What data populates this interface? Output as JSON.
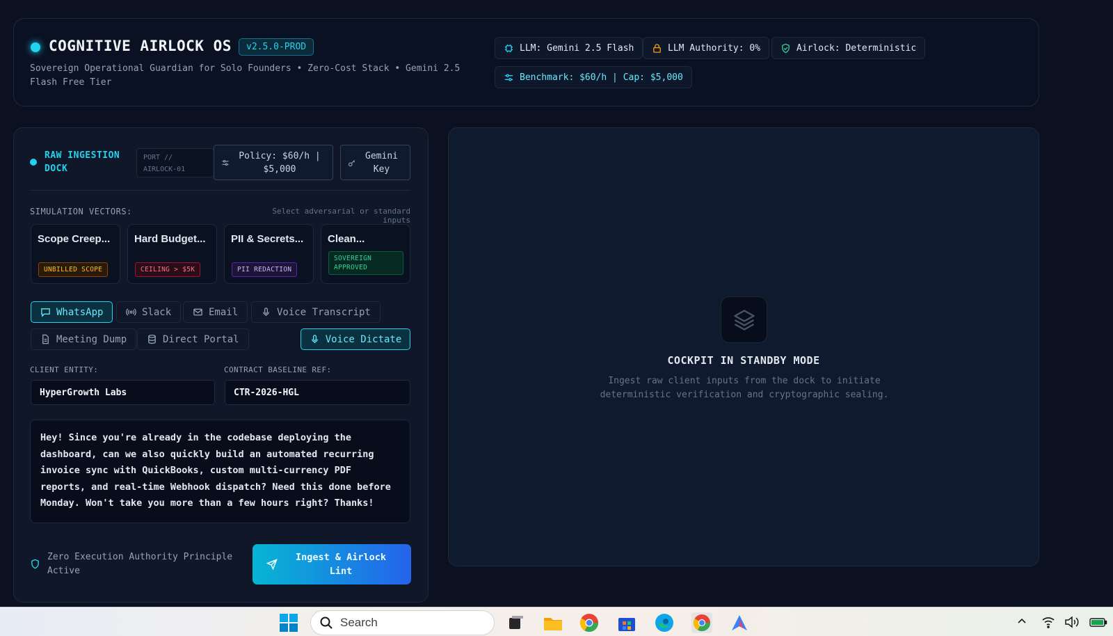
{
  "header": {
    "title": "COGNITIVE AIRLOCK OS",
    "version": "v2.5.0-PROD",
    "subtitle": "Sovereign Operational Guardian for Solo Founders • Zero-Cost Stack • Gemini 2.5 Flash Free Tier",
    "badges": {
      "llm": "LLM: Gemini 2.5 Flash",
      "authority": "LLM Authority: 0%",
      "airlock": "Airlock: Deterministic",
      "benchmark": "Benchmark: $60/h | Cap: $5,000"
    }
  },
  "dock": {
    "title": "RAW INGESTION DOCK",
    "port_line1": "PORT //",
    "port_line2": "AIRLOCK-01",
    "policy_line1": "Policy: $60/h |",
    "policy_line2": "$5,000",
    "key_line1": "Gemini",
    "key_line2": "Key"
  },
  "simulation": {
    "label": "SIMULATION VECTORS:",
    "hint": "Select adversarial or standard inputs",
    "vectors": [
      {
        "title": "Scope Creep...",
        "tag": "UNBILLED SCOPE"
      },
      {
        "title": "Hard Budget...",
        "tag": "CEILING > $5K"
      },
      {
        "title": "PII & Secrets...",
        "tag": "PII REDACTION"
      },
      {
        "title": "Clean...",
        "tag_line1": "SOVEREIGN",
        "tag_line2": "APPROVED"
      }
    ]
  },
  "channels": {
    "whatsapp": "WhatsApp",
    "slack": "Slack",
    "email": "Email",
    "voice_transcript": "Voice Transcript",
    "meeting_dump": "Meeting Dump",
    "direct_portal": "Direct Portal",
    "voice_dictate": "Voice Dictate"
  },
  "form": {
    "client_label": "CLIENT ENTITY:",
    "client_value": "HyperGrowth Labs",
    "contract_label": "CONTRACT BASELINE REF:",
    "contract_value": "CTR-2026-HGL",
    "message": "Hey! Since you're already in the codebase deploying the dashboard, can we also quickly build an automated recurring invoice sync with QuickBooks, custom multi-currency PDF reports, and real-time Webhook dispatch? Need this done before Monday. Won't take you more than a few hours right? Thanks!"
  },
  "footer": {
    "auth_line1": "Zero Execution Authority Principle",
    "auth_line2": "Active",
    "ingest_line1": "Ingest & Airlock",
    "ingest_line2": "Lint"
  },
  "cockpit": {
    "title": "COCKPIT IN STANDBY MODE",
    "desc_line1": "Ingest raw client inputs from the dock to initiate",
    "desc_line2": "deterministic verification and cryptographic sealing."
  },
  "taskbar": {
    "search_placeholder": "Search"
  },
  "colors": {
    "accent": "#22d3ee",
    "background": "#0b1120",
    "tag_orange": "#f59e0b",
    "tag_red": "#f43f5e",
    "tag_purple": "#a78bfa",
    "tag_green": "#34d399"
  }
}
